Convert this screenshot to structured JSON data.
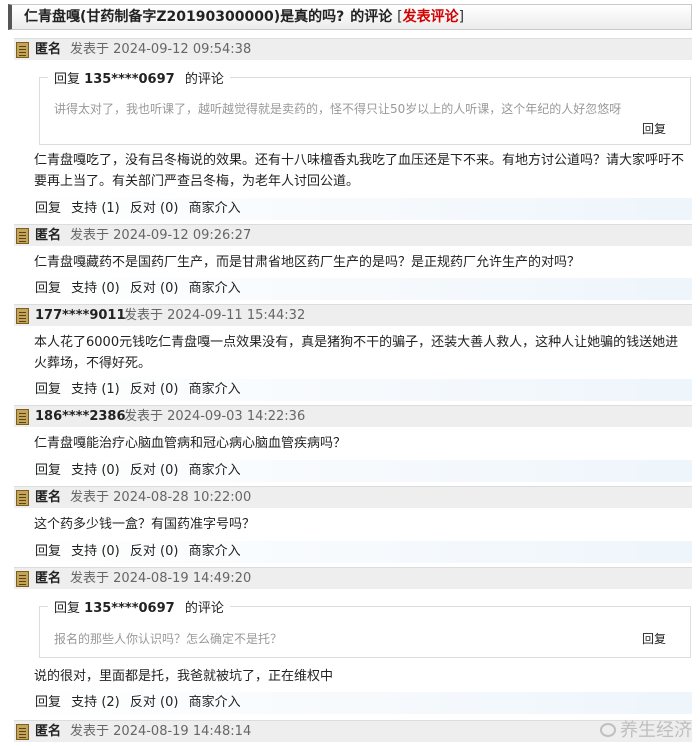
{
  "title": {
    "main": "仁青盘嘎(甘药制备字Z20190300000)是真的吗?",
    "suffix": "的评论",
    "bracket_open": "[",
    "post_link": "发表评论",
    "bracket_close": "]"
  },
  "action_labels": {
    "reply": "回复",
    "support": "支持",
    "oppose": "反对",
    "merchant": "商家介入"
  },
  "posted_prefix": "发表于",
  "comments": [
    {
      "author": "匿名",
      "time": "2024-09-12 09:54:38",
      "quote": {
        "prefix": "回复",
        "number": "135****0697",
        "suffix": "的评论",
        "text": "讲得太对了，我也听课了，越听越觉得就是卖药的，怪不得只让50岁以上的人听课，这个年纪的人好忽悠呀",
        "reply": "回复"
      },
      "text": "仁青盘嘎吃了，没有吕冬梅说的效果。还有十八味檀香丸我吃了血压还是下不来。有地方讨公道吗？请大家呼吁不要再上当了。有关部门严查吕冬梅，为老年人讨回公道。",
      "support": "(1)",
      "oppose": "(0)"
    },
    {
      "author": "匿名",
      "time": "2024-09-12 09:26:27",
      "text": "仁青盘嘎藏药不是国药厂生产，而是甘肃省地区药厂生产的是吗？是正规药厂允许生产的对吗？",
      "support": "(0)",
      "oppose": "(0)"
    },
    {
      "author": "177****9011",
      "time": "2024-09-11 15:44:32",
      "text": "本人花了6000元钱吃仁青盘嘎一点效果没有，真是猪狗不干的骗子，还装大善人救人，这种人让她骗的钱送她进火葬场，不得好死。",
      "support": "(1)",
      "oppose": "(0)"
    },
    {
      "author": "186****2386",
      "time": "2024-09-03 14:22:36",
      "text": "仁青盘嘎能治疗心脑血管病和冠心病心脑血管疾病吗？",
      "support": "(0)",
      "oppose": "(0)"
    },
    {
      "author": "匿名",
      "time": "2024-08-28 10:22:00",
      "text": "这个药多少钱一盒？有国药准字号吗？",
      "support": "(0)",
      "oppose": "(0)"
    },
    {
      "author": "匿名",
      "time": "2024-08-19 14:49:20",
      "quote": {
        "prefix": "回复",
        "number": "135****0697",
        "suffix": "的评论",
        "text": "报名的那些人你认识吗？怎么确定不是托？",
        "reply": "回复"
      },
      "text": "说的很对，里面都是托，我爸就被坑了，正在维权中",
      "support": "(2)",
      "oppose": "(0)"
    },
    {
      "author": "匿名",
      "time": "2024-08-19 14:48:14"
    }
  ],
  "watermark": "养生经济"
}
